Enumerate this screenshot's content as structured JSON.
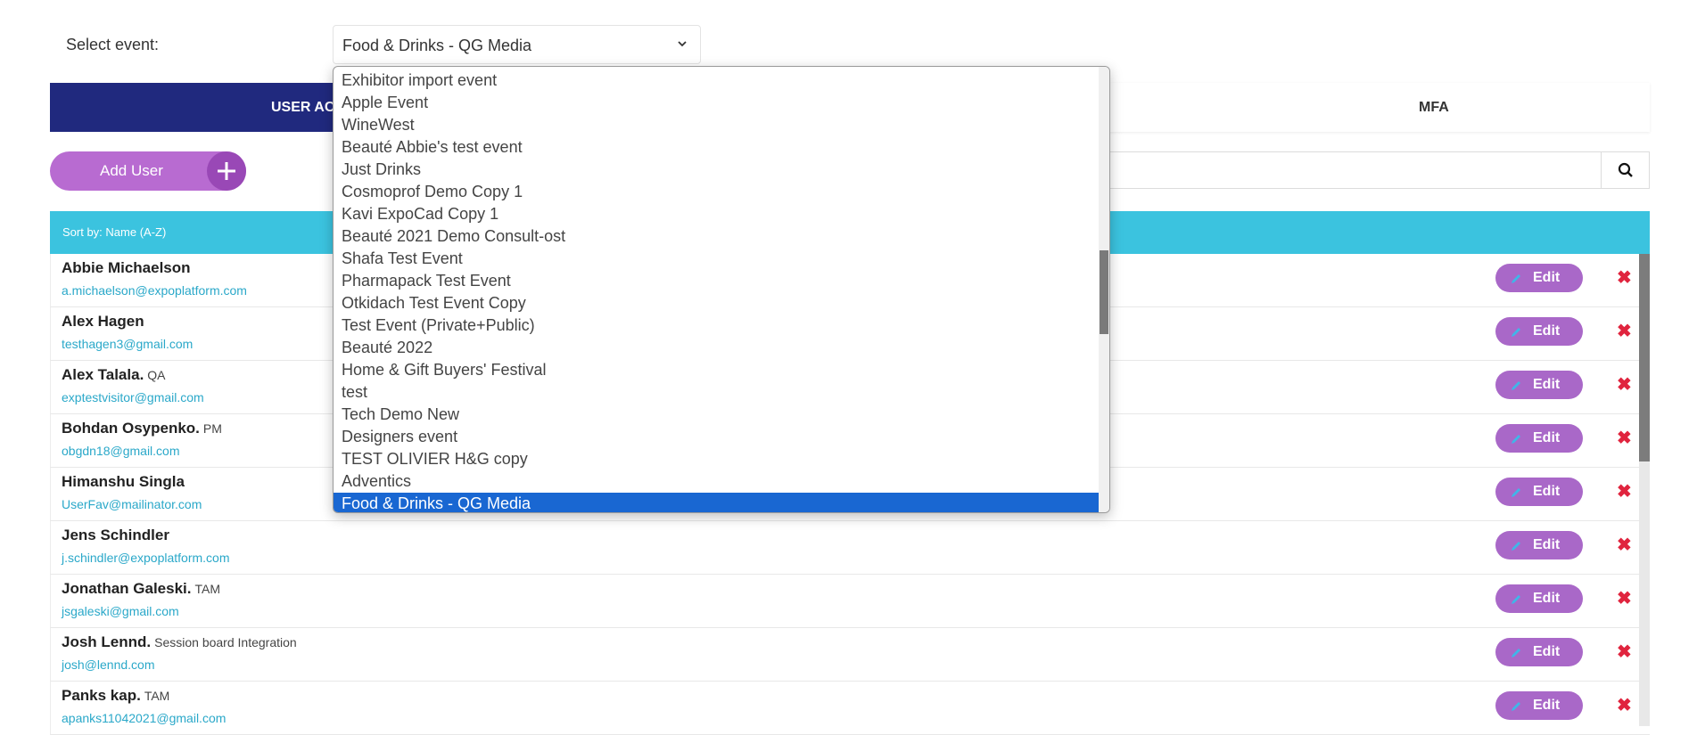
{
  "select_event": {
    "label": "Select event:",
    "value": "Food & Drinks - QG Media"
  },
  "tabs": {
    "user_accounts": "USER ACCOUNTS",
    "mfa": "MFA"
  },
  "toolbar": {
    "add_user_label": "Add User",
    "search_placeholder": ""
  },
  "sortbar": {
    "label": "Sort by:",
    "value": "Name (A-Z)"
  },
  "users": [
    {
      "name": "Abbie Michaelson",
      "role": "",
      "email": "a.michaelson@expoplatform.com"
    },
    {
      "name": "Alex Hagen",
      "role": "",
      "email": "testhagen3@gmail.com"
    },
    {
      "name": "Alex Talala.",
      "role": "QA",
      "email": "exptestvisitor@gmail.com"
    },
    {
      "name": "Bohdan Osypenko.",
      "role": "PM",
      "email": "obgdn18@gmail.com"
    },
    {
      "name": "Himanshu Singla",
      "role": "",
      "email": "UserFav@mailinator.com"
    },
    {
      "name": "Jens Schindler",
      "role": "",
      "email": "j.schindler@expoplatform.com"
    },
    {
      "name": "Jonathan Galeski.",
      "role": "TAM",
      "email": "jsgaleski@gmail.com"
    },
    {
      "name": "Josh Lennd.",
      "role": "Session board Integration",
      "email": "josh@lennd.com"
    },
    {
      "name": "Panks kap.",
      "role": "TAM",
      "email": "apanks11042021@gmail.com"
    }
  ],
  "row_actions": {
    "edit_label": "Edit",
    "delete_symbol": "✖"
  },
  "dropdown_options": [
    "Exhibitor import event",
    "Apple Event",
    "WineWest",
    "Beauté Abbie's test event",
    "Just Drinks",
    "Cosmoprof Demo Copy 1",
    "Kavi ExpoCad Copy 1",
    "Beauté 2021 Demo Consult-ost",
    "Shafa Test Event",
    "Pharmapack Test Event",
    "Otkidach Test Event Copy",
    "Test Event (Private+Public)",
    "Beauté 2022",
    "Home & Gift Buyers' Festival",
    "test",
    "Tech Demo New",
    "Designers event",
    "TEST OLIVIER H&G copy",
    "Adventics",
    "Food & Drinks - QG Media"
  ],
  "dropdown_selected": "Food & Drinks - QG Media",
  "icons": {
    "chevron": "chevron-down-icon",
    "plus": "plus-icon",
    "search": "search-icon",
    "edit": "pencil-icon",
    "delete": "close-icon"
  },
  "colors": {
    "primary_navy": "#20297e",
    "accent_purple": "#b86bd1",
    "sortbar_cyan": "#3bc3df",
    "email_link": "#2aa8c9",
    "delete_red": "#e0243e",
    "selection_blue": "#1967d2"
  }
}
